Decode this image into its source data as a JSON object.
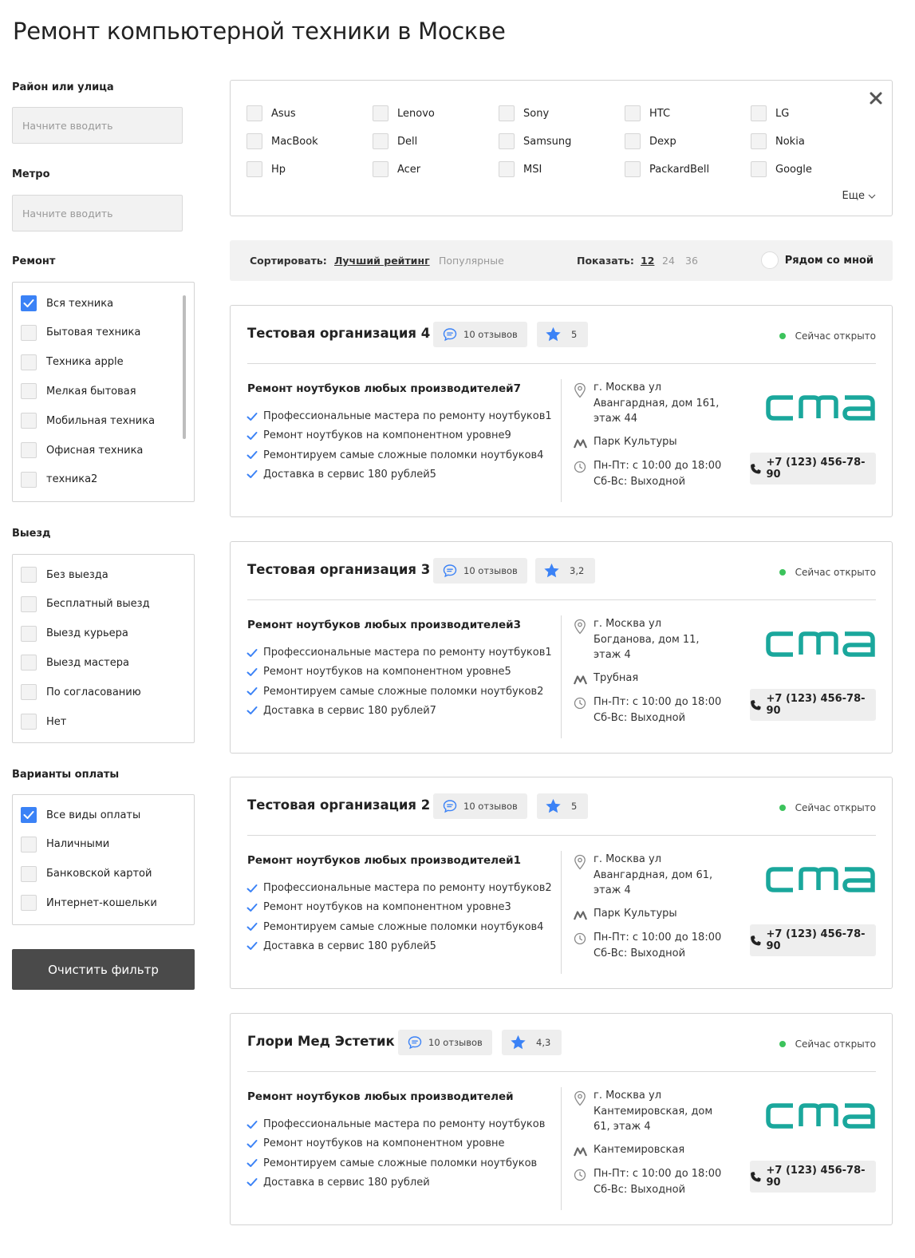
{
  "page_title": "Ремонт компьютерной техники в Москве",
  "filters": {
    "district": {
      "label": "Район или улица",
      "placeholder": "Начните вводить"
    },
    "metro": {
      "label": "Метро",
      "placeholder": "Начните вводить"
    },
    "repair": {
      "label": "Ремонт",
      "items": [
        {
          "label": "Вся техника",
          "checked": true
        },
        {
          "label": "Бытовая техника",
          "checked": false
        },
        {
          "label": "Техника apple",
          "checked": false
        },
        {
          "label": "Мелкая бытовая",
          "checked": false
        },
        {
          "label": "Мобильная техника",
          "checked": false
        },
        {
          "label": "Офисная техника",
          "checked": false
        },
        {
          "label": "техника2",
          "checked": false
        }
      ]
    },
    "visit": {
      "label": "Выезд",
      "items": [
        {
          "label": "Без выезда",
          "checked": false
        },
        {
          "label": "Бесплатный выезд",
          "checked": false
        },
        {
          "label": "Выезд курьера",
          "checked": false
        },
        {
          "label": "Выезд мастера",
          "checked": false
        },
        {
          "label": "По согласованию",
          "checked": false
        },
        {
          "label": "Нет",
          "checked": false
        }
      ]
    },
    "payment": {
      "label": "Варианты оплаты",
      "items": [
        {
          "label": "Все виды оплаты",
          "checked": true
        },
        {
          "label": "Наличными",
          "checked": false
        },
        {
          "label": "Банковской картой",
          "checked": false
        },
        {
          "label": "Интернет-кошельки",
          "checked": false
        }
      ]
    },
    "clear_label": "Очистить фильтр"
  },
  "brands": {
    "items": [
      "Asus",
      "Lenovo",
      "Sony",
      "HTC",
      "LG",
      "MacBook",
      "Dell",
      "Samsung",
      "Dexp",
      "Nokia",
      "Hp",
      "Acer",
      "MSI",
      "PackardBell",
      "Google"
    ],
    "more_label": "Еще"
  },
  "sortbar": {
    "sort_label": "Сортировать:",
    "sort_options": [
      "Лучший рейтинг",
      "Популярные"
    ],
    "sort_active": 0,
    "show_label": "Показать:",
    "show_options": [
      "12",
      "24",
      "36"
    ],
    "show_active": 0,
    "near_label": "Рядом со мной"
  },
  "colors": {
    "accent": "#3b82f6",
    "logo": "#1aa79c",
    "open": "#3cc35c",
    "button": "#4a4a4a"
  },
  "cards": [
    {
      "name": "Тестовая организация 4",
      "reviews": "10 отзывов",
      "rating": "5",
      "status": "Сейчас открыто",
      "service_title": "Ремонт ноутбуков любых производителей7",
      "features": [
        "Профессиональные мастера по ремонту ноутбуков1",
        "Ремонт ноутбуков на компонентном уровне9",
        "Ремонтируем самые сложные поломки ноутбуков4",
        "Доставка в сервис 180 рублей5"
      ],
      "address": [
        "г. Москва ул",
        "Авангардная, дом 161,",
        "этаж 44"
      ],
      "metro": "Парк Культуры",
      "hours": [
        "Пн-Пт: с 10:00 до 18:00",
        "Сб-Вс: Выходной"
      ],
      "phone": "+7 (123) 456-78-90"
    },
    {
      "name": "Тестовая организация 3",
      "reviews": "10 отзывов",
      "rating": "3,2",
      "status": "Сейчас открыто",
      "service_title": "Ремонт ноутбуков любых производителей3",
      "features": [
        "Профессиональные мастера по ремонту ноутбуков1",
        "Ремонт ноутбуков на компонентном уровне5",
        "Ремонтируем самые сложные поломки ноутбуков2",
        "Доставка в сервис 180 рублей7"
      ],
      "address": [
        "г. Москва ул",
        "Богданова, дом 11,",
        "этаж 4"
      ],
      "metro": "Трубная",
      "hours": [
        "Пн-Пт: с 10:00 до 18:00",
        "Сб-Вс: Выходной"
      ],
      "phone": "+7 (123) 456-78-90"
    },
    {
      "name": "Тестовая организация 2",
      "reviews": "10 отзывов",
      "rating": "5",
      "status": "Сейчас открыто",
      "service_title": "Ремонт ноутбуков любых производителей1",
      "features": [
        "Профессиональные мастера по ремонту ноутбуков2",
        "Ремонт ноутбуков на компонентном уровне3",
        "Ремонтируем самые сложные поломки ноутбуков4",
        "Доставка в сервис 180 рублей5"
      ],
      "address": [
        "г. Москва ул",
        "Авангардная, дом 61,",
        "этаж 4"
      ],
      "metro": "Парк Культуры",
      "hours": [
        "Пн-Пт: с 10:00 до 18:00",
        "Сб-Вс: Выходной"
      ],
      "phone": "+7 (123) 456-78-90"
    },
    {
      "name": "Глори Мед Эстетик",
      "reviews": "10 отзывов",
      "rating": "4,3",
      "status": "Сейчас открыто",
      "service_title": "Ремонт ноутбуков любых производителей",
      "features": [
        "Профессиональные мастера по ремонту ноутбуков",
        "Ремонт ноутбуков на компонентном уровне",
        "Ремонтируем самые сложные поломки ноутбуков",
        "Доставка в сервис 180 рублей"
      ],
      "address": [
        "г. Москва ул",
        "Кантемировская, дом",
        "61, этаж 4"
      ],
      "metro": "Кантемировская",
      "hours": [
        "Пн-Пт: с 10:00 до 18:00",
        "Сб-Вс: Выходной"
      ],
      "phone": "+7 (123) 456-78-90"
    }
  ]
}
